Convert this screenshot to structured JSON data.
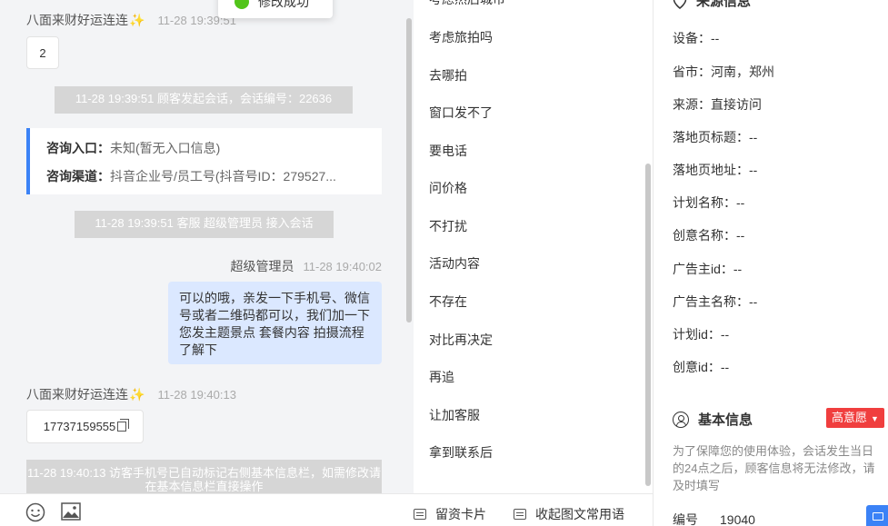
{
  "toast": {
    "text": "修改成功"
  },
  "chat": {
    "customer_name": "八面来财好运连连",
    "msg1": {
      "time": "11-28 19:39:51",
      "text": "2"
    },
    "sys1": "11-28 19:39:51 顾客发起会话，会话编号：22636",
    "entry": {
      "label1": "咨询入口：",
      "value1": "未知(暂无入口信息)",
      "label2": "咨询渠道：",
      "value2": "抖音企业号/员工号(抖音号ID：279527..."
    },
    "sys2": "11-28 19:39:51 客服 超级管理员 接入会话",
    "agent": {
      "name": "超级管理员",
      "time": "11-28 19:40:02",
      "text": "可以的哦，亲发一下手机号、微信号或者二维码都可以，我们加一下您发主题景点 套餐内容 拍摄流程了解下"
    },
    "msg2": {
      "time": "11-28 19:40:13",
      "text": "17737159555"
    },
    "sys3": "11-28 19:40:13 访客手机号已自动标记右侧基本信息栏，如需修改请在基本信息栏直接操作"
  },
  "toolbar": {
    "emoji_icon": "smile-icon",
    "image_icon": "image-icon"
  },
  "quick_replies": {
    "items": [
      "考虑然后城市",
      "考虑旅拍吗",
      "去哪拍",
      "窗口发不了",
      "要电话",
      "问价格",
      "不打扰",
      "活动内容",
      "不存在",
      "对比再决定",
      "再追",
      "让加客服",
      "拿到联系后"
    ],
    "footer": {
      "card": "留资卡片",
      "collapse": "收起图文常用语"
    }
  },
  "info": {
    "source_title": "来源信息",
    "source_rows": [
      "设备：--",
      "省市：河南，郑州",
      "来源：直接访问",
      "落地页标题：--",
      "落地页地址：--",
      "计划名称：--",
      "创意名称：--",
      "广告主id：--",
      "广告主名称：--",
      "计划id：--",
      "创意id：--"
    ],
    "basic_title": "基本信息",
    "intent_badge": "高意愿",
    "note": "为了保障您的使用体验，会话发生当日的24点之后，顾客信息将无法修改，请及时填写",
    "id_label": "编号",
    "id_value": "19040"
  }
}
